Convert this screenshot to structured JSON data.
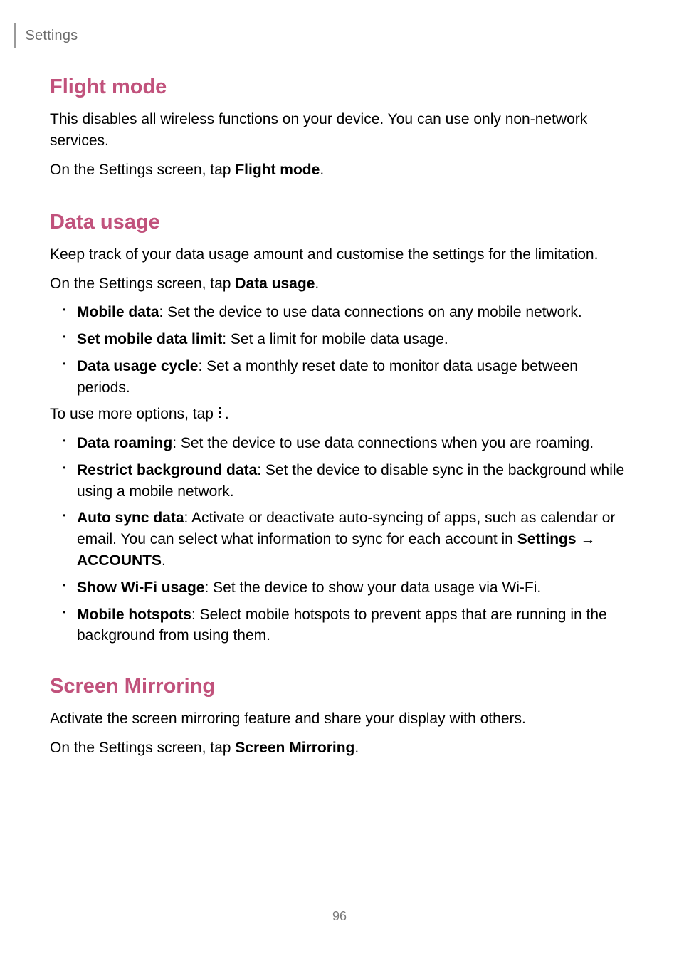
{
  "header": {
    "breadcrumb": "Settings"
  },
  "page_number": "96",
  "sections": {
    "flight": {
      "title": "Flight mode",
      "p1": "This disables all wireless functions on your device. You can use only non-network services.",
      "p2a": "On the Settings screen, tap ",
      "p2b": "Flight mode",
      "p2c": "."
    },
    "data": {
      "title": "Data usage",
      "p1": "Keep track of your data usage amount and customise the settings for the limitation.",
      "p2a": "On the Settings screen, tap ",
      "p2b": "Data usage",
      "p2c": ".",
      "list1": [
        {
          "b": "Mobile data",
          "t": ": Set the device to use data connections on any mobile network."
        },
        {
          "b": "Set mobile data limit",
          "t": ": Set a limit for mobile data usage."
        },
        {
          "b": "Data usage cycle",
          "t": ": Set a monthly reset date to monitor data usage between periods."
        }
      ],
      "more_a": "To use more options, tap ",
      "more_b": ".",
      "list2": [
        {
          "b": "Data roaming",
          "t": ": Set the device to use data connections when you are roaming."
        },
        {
          "b": "Restrict background data",
          "t": ": Set the device to disable sync in the background while using a mobile network."
        },
        {
          "b": "Auto sync data",
          "t1": ": Activate or deactivate auto-syncing of apps, such as calendar or email. You can select what information to sync for each account in ",
          "s": "Settings",
          "arrow": " → ",
          "a": "ACCOUNTS",
          "t2": "."
        },
        {
          "b": "Show Wi-Fi usage",
          "t": ": Set the device to show your data usage via Wi-Fi."
        },
        {
          "b": "Mobile hotspots",
          "t": ": Select mobile hotspots to prevent apps that are running in the background from using them."
        }
      ]
    },
    "mirror": {
      "title": "Screen Mirroring",
      "p1": "Activate the screen mirroring feature and share your display with others.",
      "p2a": "On the Settings screen, tap ",
      "p2b": "Screen Mirroring",
      "p2c": "."
    }
  }
}
